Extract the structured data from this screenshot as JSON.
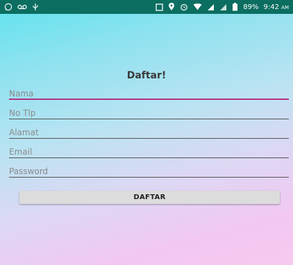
{
  "status_bar": {
    "left_icons": [
      "whatsapp-icon",
      "voicemail-icon",
      "usb-icon"
    ],
    "right_icons": [
      "screen-cast-icon",
      "location-icon",
      "alarm-icon",
      "wifi-icon",
      "signal-icon",
      "signal-2-icon",
      "battery-icon"
    ],
    "battery": "89%",
    "time": "9:42",
    "ampm": "AM"
  },
  "form": {
    "title": "Daftar!",
    "fields": [
      {
        "placeholder": "Nama",
        "value": "",
        "focused": true
      },
      {
        "placeholder": "No Tlp",
        "value": ""
      },
      {
        "placeholder": "Alamat",
        "value": ""
      },
      {
        "placeholder": "Email",
        "value": ""
      },
      {
        "placeholder": "Password",
        "value": ""
      }
    ],
    "submit_label": "DAFTAR"
  },
  "colors": {
    "status_bar": "#0b6e60",
    "accent": "#b2327f",
    "button": "#dcdcdc"
  }
}
